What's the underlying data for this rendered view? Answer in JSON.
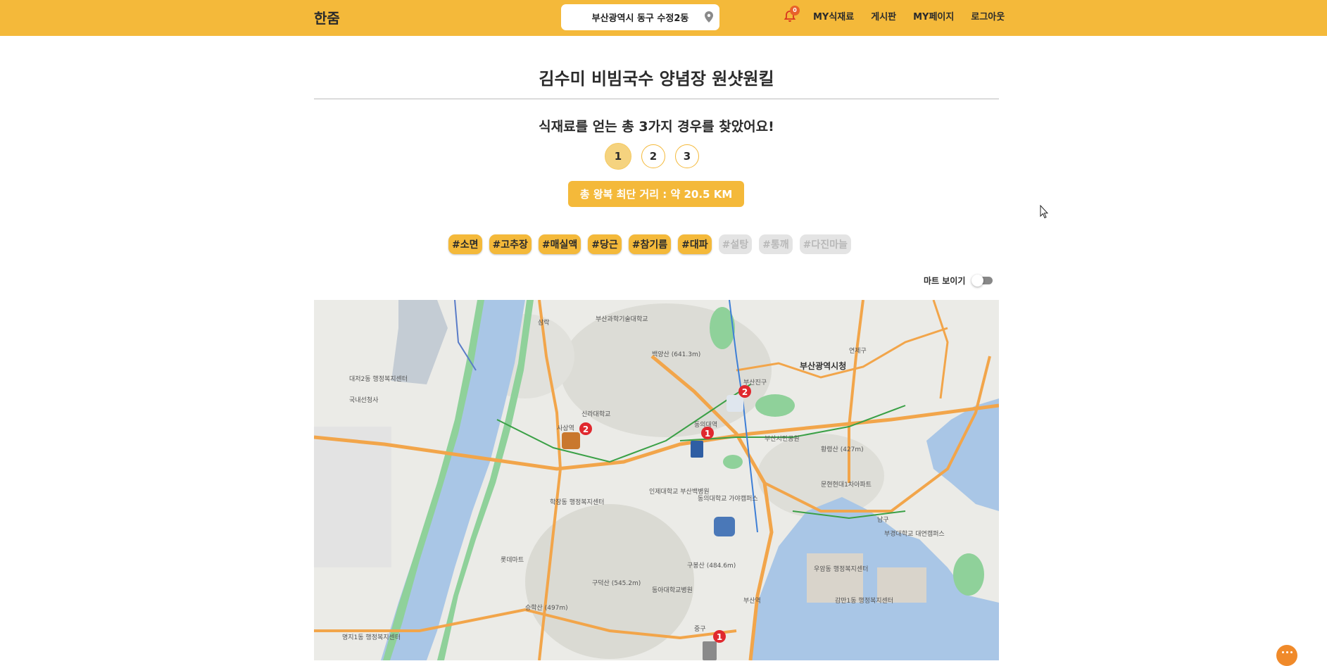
{
  "header": {
    "logo": "한줌",
    "location": "부산광역시 동구 수정2동",
    "notification_count": "0",
    "nav": [
      "MY식재료",
      "게시판",
      "MY페이지",
      "로그아웃"
    ]
  },
  "recipe": {
    "title": "김수미 비빔국수 양념장 원샷원킬",
    "subtitle": "식재료를 얻는 총 3가지 경우를 찾았어요!",
    "pages": [
      "1",
      "2",
      "3"
    ],
    "active_page": "1",
    "distance_text": "총 왕복 최단 거리 : 약 20.5 KM"
  },
  "ingredients": [
    {
      "label": "#소면",
      "available": true
    },
    {
      "label": "#고추장",
      "available": true
    },
    {
      "label": "#매실액",
      "available": true
    },
    {
      "label": "#당근",
      "available": true
    },
    {
      "label": "#참기름",
      "available": true
    },
    {
      "label": "#대파",
      "available": true
    },
    {
      "label": "#설탕",
      "available": false
    },
    {
      "label": "#통깨",
      "available": false
    },
    {
      "label": "#다진마늘",
      "available": false
    }
  ],
  "mart_toggle": {
    "label": "마트 보이기",
    "on": false
  },
  "map": {
    "labels": [
      {
        "text": "삼락",
        "id": "l1"
      },
      {
        "text": "부산과학기술대학교",
        "id": "l2"
      },
      {
        "text": "백양산 (641.3m)",
        "id": "l3"
      },
      {
        "text": "부산진구",
        "id": "l4"
      },
      {
        "text": "부산광역시청",
        "id": "l5"
      },
      {
        "text": "연제구",
        "id": "l6"
      },
      {
        "text": "대저2동 행정복지센터",
        "id": "l7"
      },
      {
        "text": "국내선청사",
        "id": "l8"
      },
      {
        "text": "사상역",
        "id": "l9"
      },
      {
        "text": "신라대학교",
        "id": "l10"
      },
      {
        "text": "동의대역",
        "id": "l11"
      },
      {
        "text": "부산시민공원",
        "id": "l12"
      },
      {
        "text": "황령산 (427m)",
        "id": "l13"
      },
      {
        "text": "학장동 행정복지센터",
        "id": "l14"
      },
      {
        "text": "인제대학교 부산백병원",
        "id": "l15"
      },
      {
        "text": "동의대학교 가야캠퍼스",
        "id": "l16"
      },
      {
        "text": "문현현대1차아파트",
        "id": "l17"
      },
      {
        "text": "부경대학교 대연캠퍼스",
        "id": "l18"
      },
      {
        "text": "롯데마트",
        "id": "l19"
      },
      {
        "text": "구봉산 (484.6m)",
        "id": "l20"
      },
      {
        "text": "구덕산 (545.2m)",
        "id": "l21"
      },
      {
        "text": "동아대학교병원",
        "id": "l22"
      },
      {
        "text": "우암동 행정복지센터",
        "id": "l23"
      },
      {
        "text": "감만1동 행정복지센터",
        "id": "l24"
      },
      {
        "text": "승학산 (497m)",
        "id": "l25"
      },
      {
        "text": "명지1동 행정복지센터",
        "id": "l26"
      },
      {
        "text": "중구",
        "id": "l27"
      },
      {
        "text": "부산역",
        "id": "l28"
      },
      {
        "text": "남구",
        "id": "l29"
      }
    ],
    "markers": [
      "1",
      "2",
      "2",
      "1"
    ]
  },
  "colors": {
    "brand": "#f4b93a",
    "tag_off": "#e4e4e4",
    "marker": "#e0282e",
    "water": "#a9c6e6",
    "park": "#78c58c",
    "road": "#f2a54a"
  }
}
